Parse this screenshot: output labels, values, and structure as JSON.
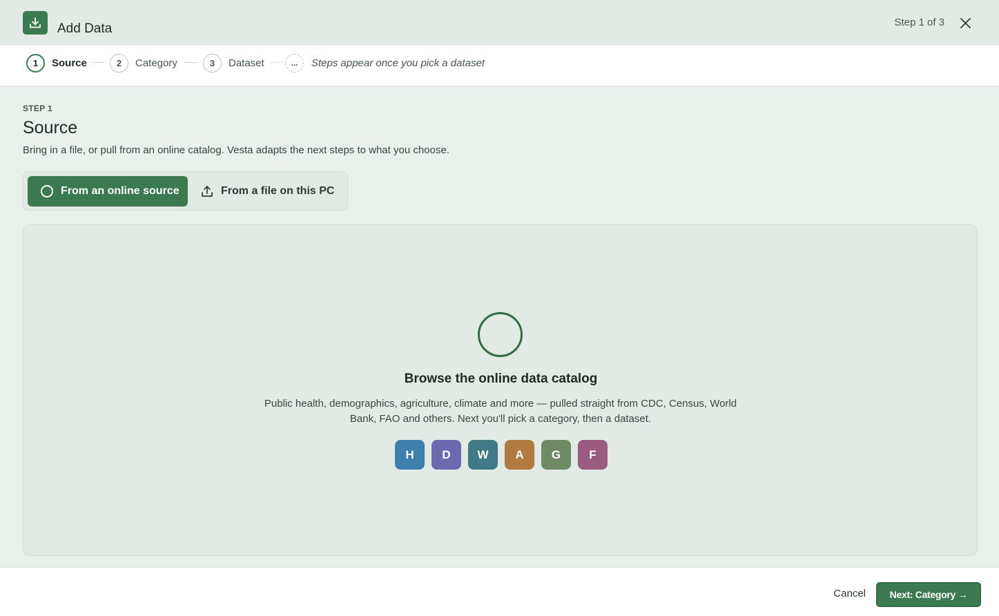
{
  "header": {
    "title": "Add Data",
    "step_indicator": "Step 1 of 3",
    "icon": "download-icon",
    "close_icon": "close-icon"
  },
  "stepper": {
    "steps": [
      {
        "number": "1",
        "label": "Source",
        "active": true
      },
      {
        "number": "2",
        "label": "Category",
        "active": false
      },
      {
        "number": "3",
        "label": "Dataset",
        "active": false
      }
    ],
    "pending": {
      "marker": "...",
      "label": "Steps appear once you pick a dataset"
    }
  },
  "content": {
    "kicker": "STEP 1",
    "title": "Source",
    "description": "Bring in a file, or pull from an online catalog. Vesta adapts the next steps to what you choose.",
    "options": {
      "online": "From an online source",
      "file": "From a file on this PC"
    }
  },
  "panel": {
    "title": "Browse the online data catalog",
    "description": "Public health, demographics, agriculture, climate and more — pulled straight from CDC, Census, World Bank, FAO and others. Next you'll pick a category, then a dataset.",
    "sources": [
      {
        "letter": "H",
        "color": "#3f7fb0"
      },
      {
        "letter": "D",
        "color": "#6b6ab0"
      },
      {
        "letter": "W",
        "color": "#3f7a86"
      },
      {
        "letter": "A",
        "color": "#b07a40"
      },
      {
        "letter": "G",
        "color": "#6d8a63"
      },
      {
        "letter": "F",
        "color": "#9a5b7f"
      }
    ]
  },
  "footer": {
    "cancel": "Cancel",
    "next": "Next: Category →"
  },
  "colors": {
    "accent": "#3b7a50",
    "header_bg": "#e1ebe4",
    "page_bg": "#eaf1ec"
  }
}
